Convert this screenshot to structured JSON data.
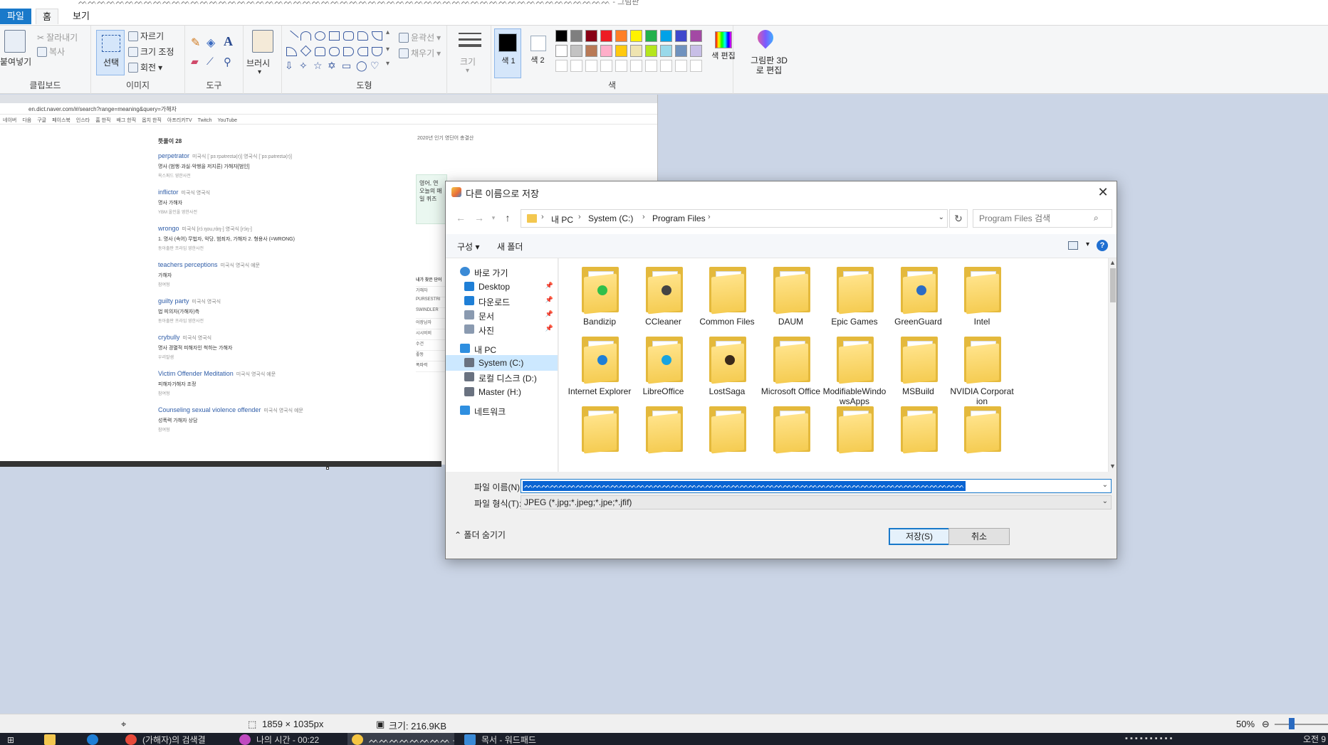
{
  "window": {
    "title_partial": "ᨓᨓᨓᨓᨓᨓᨓᨓᨓᨓᨓᨓᨓᨓᨓᨓᨓᨓᨓᨓᨓᨓᨓᨓᨓᨓᨓᨓᨓᨓᨓᨓᨓᨓᨓᨓᨓᨓᨓᨓᨓᨓᨓᨓᨓᨓᨓᨓᨓᨓᨓᨓᨓᨓᨓᨓᨓ - 그림판"
  },
  "tabs": {
    "file": "파일",
    "home": "홈",
    "view": "보기"
  },
  "ribbon": {
    "clipboard": {
      "label": "클립보드",
      "paste": "붙여넣기",
      "cut": "잘라내기",
      "copy": "복사"
    },
    "image": {
      "label": "이미지",
      "select": "선택",
      "crop": "자르기",
      "resize": "크기 조정",
      "rotate": "회전"
    },
    "tools": {
      "label": "도구"
    },
    "brushes": {
      "label": "브러시"
    },
    "shapes": {
      "label": "도형",
      "outline": "윤곽선",
      "fill": "채우기"
    },
    "size": {
      "label": "크기"
    },
    "colors": {
      "label": "색",
      "color1": "색 1",
      "color2": "색 2",
      "edit": "색 편집",
      "paint3d": "그림판 3D로 편집",
      "row1": [
        "#000000",
        "#7f7f7f",
        "#880015",
        "#ed1c24",
        "#ff7f27",
        "#fff200",
        "#22b14c",
        "#00a2e8",
        "#3f48cc",
        "#a349a4"
      ],
      "row2": [
        "#ffffff",
        "#c3c3c3",
        "#b97a57",
        "#ffaec9",
        "#ffc90e",
        "#efe4b0",
        "#b5e61d",
        "#99d9ea",
        "#7092be",
        "#c8bfe7"
      ]
    }
  },
  "browser": {
    "url": "en.dict.naver.com/#/search?range=meaning&query=가해자",
    "bookmarks": [
      "네이버",
      "다음",
      "구글",
      "페이스북",
      "인스타",
      "홈 한직",
      "배그 한직",
      "옵치 한직",
      "아프리카TV",
      "Twitch",
      "YouTube"
    ],
    "result_head": "뜻풀이 28",
    "side_note": "2020년 인기 영단어 총결산",
    "side_box": "영어, 연 오늘의 매일 퀴즈",
    "side_list_head": "내가 찾은 단어",
    "side_list": [
      "가해자",
      "PURSESTRI",
      "SWINDLER",
      "어장남자",
      "시시비비",
      "수건",
      "좋동",
      "폭파력"
    ],
    "entries": [
      {
        "word": "perpetrator",
        "pron": "미국식 [ˈpɜːrpətreɪtə(r)] 영국식 [ˈpɜːpətreɪtə(r)]",
        "def": "명사 (범행·과실·악행을 저지른) 가해자[범인]",
        "src": "옥스퍼드 영한사전"
      },
      {
        "word": "inflictor",
        "pron": "미국식 영국식",
        "def": "명사 가해자",
        "src": "YBM 올인올 영한사전"
      },
      {
        "word": "wrongo",
        "pron": "미국식 [rɔ́ːŋou,rάŋ-] 영국식 [rɔ́ŋ-]",
        "def": "1. 명사 (속어) 무법자, 악당, 범죄자, 가해자  2. 형용사 (=WRONG)",
        "src": "동아출판 프라임 영한사전"
      },
      {
        "word": "teachers perceptions",
        "pron": "미국식 영국식 예문",
        "def": "가해자",
        "src": "참여형"
      },
      {
        "word": "guilty party",
        "pron": "미국식 영국식",
        "def": "법 피의자(가해자)측",
        "src": "동아출판 프라임 영한사전"
      },
      {
        "word": "crybully",
        "pron": "미국식 영국식",
        "def": "명사 경멸적 피해자인 척하는 가해자",
        "src": "우리말샘"
      },
      {
        "word": "Victim Offender Meditation",
        "pron": "미국식 영국식 예문",
        "def": "피해자가해자 조정",
        "src": "참여형"
      },
      {
        "word": "Counseling sexual violence offender",
        "pron": "미국식 영국식 예문",
        "def": "성폭력 가해자 상담",
        "src": "참여형"
      }
    ]
  },
  "dialog": {
    "title": "다른 이름으로 저장",
    "breadcrumb": [
      "내 PC",
      "System (C:)",
      "Program Files"
    ],
    "search_placeholder": "Program Files 검색",
    "organize": "구성",
    "new_folder": "새 폴더",
    "help": "?",
    "nav": [
      {
        "label": "바로 가기",
        "icon": "star-icon",
        "pin": false
      },
      {
        "label": "Desktop",
        "icon": "desktop-icon",
        "pin": true
      },
      {
        "label": "다운로드",
        "icon": "download-icon",
        "pin": true
      },
      {
        "label": "문서",
        "icon": "documents-icon",
        "pin": true
      },
      {
        "label": "사진",
        "icon": "pictures-icon",
        "pin": true
      },
      {
        "label": "내 PC",
        "icon": "pc-icon",
        "pin": false
      },
      {
        "label": "System (C:)",
        "icon": "drive-icon",
        "pin": false
      },
      {
        "label": "로컬 디스크 (D:)",
        "icon": "drive-icon",
        "pin": false
      },
      {
        "label": "Master (H:)",
        "icon": "drive-icon",
        "pin": false
      },
      {
        "label": "네트워크",
        "icon": "network-icon",
        "pin": false
      }
    ],
    "folders": [
      {
        "name": "Bandizip",
        "badge": "#2fbf4a"
      },
      {
        "name": "CCleaner",
        "badge": "#444444"
      },
      {
        "name": "Common Files",
        "badge": ""
      },
      {
        "name": "DAUM",
        "badge": ""
      },
      {
        "name": "Epic Games",
        "badge": ""
      },
      {
        "name": "GreenGuard",
        "badge": "#2b6cc4"
      },
      {
        "name": "Intel",
        "badge": ""
      },
      {
        "name": "Internet Explorer",
        "badge": "#1f7fd6"
      },
      {
        "name": "LibreOffice",
        "badge": "#18a4e0"
      },
      {
        "name": "LostSaga",
        "badge": "#3a2a1a"
      },
      {
        "name": "Microsoft Office",
        "badge": ""
      },
      {
        "name": "ModifiableWindowsApps",
        "badge": ""
      },
      {
        "name": "MSBuild",
        "badge": ""
      },
      {
        "name": "NVIDIA Corporation",
        "badge": ""
      }
    ],
    "filename_label": "파일 이름(N):",
    "filename_value": "ᨓᨓᨓᨓᨓᨓᨓᨓᨓᨓᨓᨓᨓᨓᨓᨓᨓᨓᨓᨓᨓᨓᨓᨓᨓᨓᨓᨓᨓᨓᨓᨓᨓᨓᨓᨓᨓᨓᨓᨓᨓᨓᨓᨓᨓᨓᨓᨓᨓᨓᨓ",
    "filetype_label": "파일 형식(T):",
    "filetype_value": "JPEG (*.jpg;*.jpeg;*.jpe;*.jfif)",
    "hide_folders": "폴더 숨기기",
    "save": "저장(S)",
    "cancel": "취소"
  },
  "status": {
    "dimensions": "1859 × 1035px",
    "size": "크기: 216.9KB",
    "zoom": "50%"
  },
  "taskbar": {
    "items": [
      "(가해자)의 검색결",
      "나의 시간 - 00:22",
      "ᨓᨓᨓᨓᨓᨓᨓᨓ - 그림판",
      "목서 - 워드패드"
    ],
    "clock": "오전 9"
  }
}
